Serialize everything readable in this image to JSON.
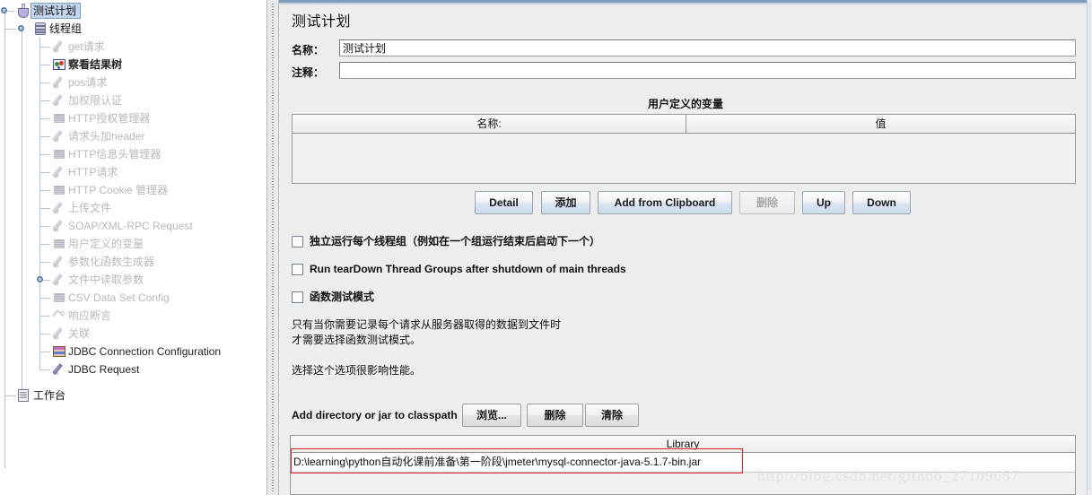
{
  "tree": {
    "root": {
      "label": "测试计划",
      "icon": "flask-icon",
      "selected": true
    },
    "thread_group": {
      "label": "线程组",
      "icon": "spool-icon"
    },
    "items": [
      {
        "label": "get请求",
        "icon": "pencil-icon",
        "enabled": false
      },
      {
        "label": "察看结果树",
        "icon": "result-tree-icon",
        "enabled": true
      },
      {
        "label": "pos请求",
        "icon": "pencil-icon",
        "enabled": false
      },
      {
        "label": "加权限认证",
        "icon": "pencil-icon",
        "enabled": false
      },
      {
        "label": "HTTP授权管理器",
        "icon": "gear-icon",
        "enabled": false
      },
      {
        "label": "请求头加header",
        "icon": "pencil-icon",
        "enabled": false
      },
      {
        "label": "HTTP信息头管理器",
        "icon": "gear-icon",
        "enabled": false
      },
      {
        "label": "HTTP请求",
        "icon": "pencil-icon",
        "enabled": false
      },
      {
        "label": "HTTP Cookie 管理器",
        "icon": "gear-icon",
        "enabled": false
      },
      {
        "label": "上传文件",
        "icon": "pencil-icon",
        "enabled": false
      },
      {
        "label": "SOAP/XML-RPC Request",
        "icon": "pencil-icon",
        "enabled": false
      },
      {
        "label": "用户定义的变量",
        "icon": "gear-icon",
        "enabled": false
      },
      {
        "label": "参数化函数生成器",
        "icon": "pencil-icon",
        "enabled": false
      },
      {
        "label": "文件中读取参数",
        "icon": "pencil-icon",
        "enabled": false,
        "expander": true
      },
      {
        "label": "CSV Data Set Config",
        "icon": "gear-icon",
        "enabled": false
      },
      {
        "label": "响应断言",
        "icon": "assertion-icon",
        "enabled": false
      },
      {
        "label": "关联",
        "icon": "pencil-icon",
        "enabled": false
      },
      {
        "label": "JDBC Connection Configuration",
        "icon": "jdbc-config-icon",
        "enabled": true
      },
      {
        "label": "JDBC Request",
        "icon": "jdbc-request-icon",
        "enabled": true
      }
    ],
    "workbench": {
      "label": "工作台",
      "icon": "clipboard-icon"
    }
  },
  "panel": {
    "title": "测试计划",
    "name_label": "名称：",
    "name_value": "测试计划",
    "comment_label": "注释：",
    "comment_value": "",
    "comment_placeholder": "",
    "variables_title": "用户定义的变量",
    "variables_table": {
      "columns": [
        "名称:",
        "值"
      ],
      "rows": []
    },
    "variable_buttons": [
      {
        "label": "Detail",
        "disabled": false
      },
      {
        "label": "添加",
        "disabled": false
      },
      {
        "label": "Add from Clipboard",
        "disabled": false
      },
      {
        "label": "删除",
        "disabled": true
      },
      {
        "label": "Up",
        "disabled": false
      },
      {
        "label": "Down",
        "disabled": false
      }
    ],
    "checkboxes": [
      {
        "label": "独立运行每个线程组（例如在一个组运行结束后启动下一个）",
        "checked": false
      },
      {
        "label": "Run tearDown Thread Groups after shutdown of main threads",
        "checked": false
      },
      {
        "label": "函数测试模式",
        "checked": false
      }
    ],
    "help_lines": [
      "只有当你需要记录每个请求从服务器取得的数据到文件时",
      "才需要选择函数测试模式。",
      "选择这个选项很影响性能。"
    ],
    "classpath_label": "Add directory or jar to classpath",
    "classpath_buttons": [
      {
        "label": "浏览...",
        "disabled": false
      },
      {
        "label": "删除",
        "disabled": false
      },
      {
        "label": "清除",
        "disabled": false
      }
    ],
    "library_table": {
      "column": "Library",
      "rows": [
        "D:\\learning\\python自动化课前准备\\第一阶段\\jmeter\\mysql-connector-java-5.1.7-bin.jar"
      ]
    }
  },
  "watermark": "http://blog.csdn.net/github_27109687",
  "colors": {
    "accent_blue": "#7e9dbb",
    "selection": "#c3d5ec",
    "highlight_red": "#e2252a",
    "panel_bg": "#eeeeee",
    "disabled_text": "#b9b9be"
  }
}
